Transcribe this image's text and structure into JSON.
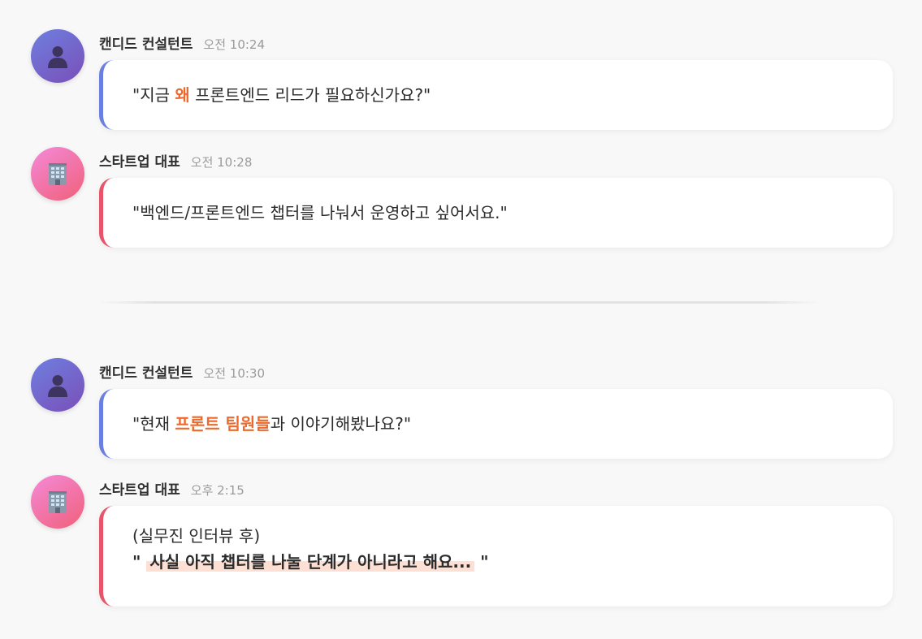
{
  "messages": [
    {
      "sender": "캔디드 컨설턴트",
      "time": "오전 10:24",
      "avatar": "person-icon",
      "text": {
        "before": "\"지금 ",
        "highlight": "왜",
        "after": " 프론트엔드 리드가 필요하신가요?\""
      }
    },
    {
      "sender": "스타트업 대표",
      "time": "오전 10:28",
      "avatar": "office-building-icon",
      "text": "\"백엔드/프론트엔드 챕터를 나눠서 운영하고 싶어서요.\""
    },
    {
      "sender": "캔디드 컨설턴트",
      "time": "오전 10:30",
      "avatar": "person-icon",
      "text": {
        "before": "\"현재 ",
        "highlight": "프론트 팀원들",
        "after": "과 이야기해봤나요?\""
      }
    },
    {
      "sender": "스타트업 대표",
      "time": "오후 2:15",
      "avatar": "office-building-icon",
      "text": {
        "line1": "(실무진 인터뷰 후)",
        "open_quote": "\"",
        "highlight": "사실 아직 챕터를 나눌 단계가 아니라고 해요...",
        "close_quote": "\""
      }
    }
  ],
  "colors": {
    "consultant_accent": "#6a7fe0",
    "ceo_accent": "#e8546a",
    "highlight_text": "#ec6a2d",
    "highlight_background": "#fde0d3"
  }
}
